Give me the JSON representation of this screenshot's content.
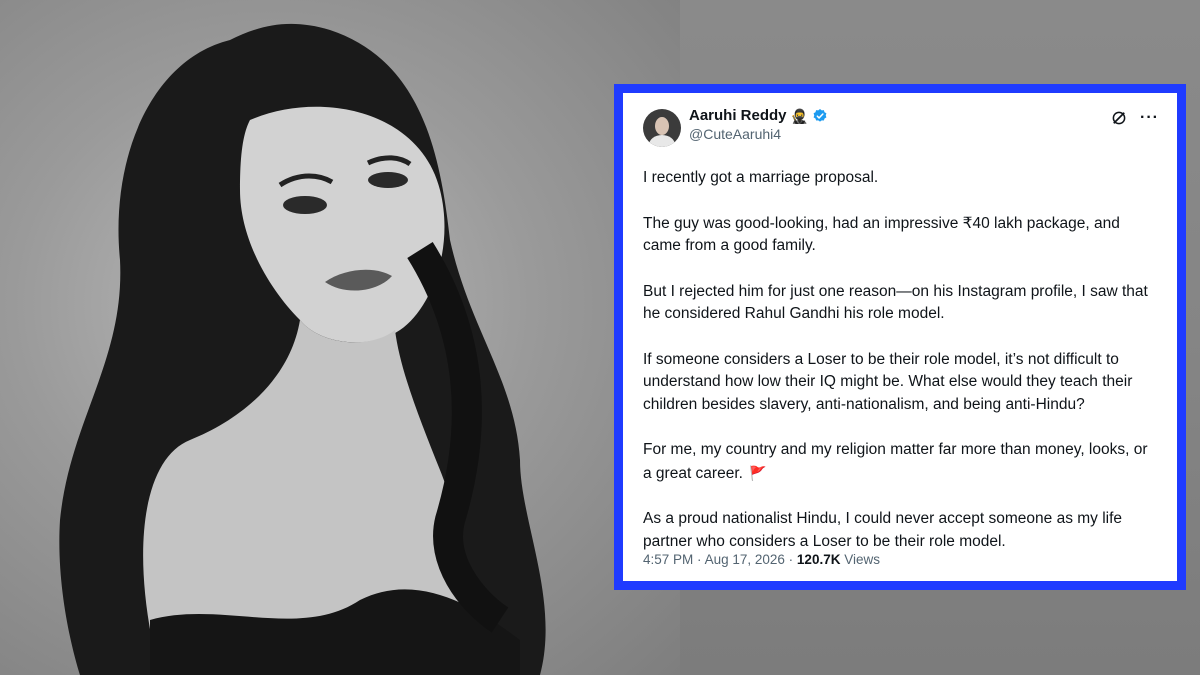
{
  "tweet": {
    "author_name": "Aaruhi Reddy",
    "author_emoji": "🥷",
    "handle": "@CuteAaruhi4",
    "paragraphs": [
      "I recently got a marriage proposal.",
      "The guy was good-looking, had an impressive ₹40 lakh package, and came from a good family.",
      "But I rejected him for just one reason—on his Instagram profile, I saw that he considered Rahul Gandhi his role model.",
      "If someone considers a Loser to be their role model, it’s not difficult to understand how low their IQ might be. What else would they teach their children besides slavery, anti-nationalism, and being anti-Hindu?",
      "For me, my country and my religion matter far more than money, looks, or a great career.",
      "As a proud nationalist Hindu, I could never accept someone as my life partner who considers a Loser to be their role model."
    ],
    "flag_emoji": "🚩",
    "time": "4:57 PM",
    "separator": "·",
    "date": "Aug 17, 2026",
    "views_count": "120.7K",
    "views_label": "Views",
    "more_glyph": "···"
  },
  "colors": {
    "frame": "#1f3bff",
    "verified": "#1d9bf0",
    "text": "#0f1419",
    "muted": "#536471"
  },
  "icons": [
    "verified-badge-icon",
    "grok-icon",
    "more-options-icon"
  ]
}
